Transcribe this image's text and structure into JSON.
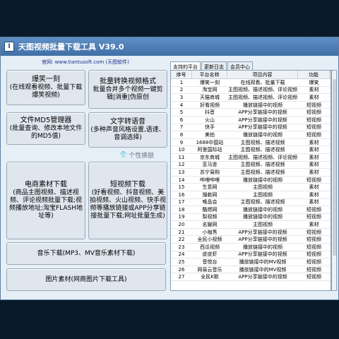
{
  "app": {
    "title": "天图视频批量下载工具 V39.0",
    "icon_label": "I"
  },
  "official": {
    "label": "官网:",
    "url": "www.tiantusoft.com",
    "paren": "(天图软件)"
  },
  "buttons": {
    "b1": {
      "main": "爆笑一刻",
      "sub": "(在线观看视频、批量下载爆笑视频)"
    },
    "b2": {
      "main": "批量转换视频格式",
      "sub": "批量合并多个视频一键剪辑|消重|伪原创"
    },
    "b3": {
      "main": "文件MD5管理器",
      "sub": "(批量查询、修改本地文件的MD5值)"
    },
    "b4": {
      "main": "文字转语音",
      "sub": "(多种声音风格设置,语速、音调选择)"
    },
    "skin": "个性换肤",
    "b5": {
      "main": "电商素材下载",
      "sub": "(商品主图视频、描述视频、评论视频批量下载;视频播放地址;淘宝FLASH地址等)"
    },
    "b6": {
      "main": "短视频下载",
      "sub": "(好看视频、抖音视频、美拍视频、火山视频、快手视频等播放链接或APP分享链接批量下载;网址批量生成)"
    },
    "b7": {
      "main": "音乐下载(MP3、MV音乐素材下载)"
    },
    "b8": {
      "main": "图片素材(网商图片下载工具)"
    }
  },
  "tabs": [
    "支持的平台",
    "更新日志",
    "会员中心"
  ],
  "table": {
    "columns": [
      "序号",
      "平台名称",
      "项目内容",
      "功能"
    ],
    "rows": [
      [
        "1",
        "爆笑一刻",
        "在线观看、批量下载",
        "爆笑"
      ],
      [
        "2",
        "淘宝网",
        "主图视频、描述视频、评论视频",
        "素材"
      ],
      [
        "3",
        "天猫商城",
        "主图视频、描述视频、评论视频",
        "素材"
      ],
      [
        "4",
        "好看视频",
        "播放链接中的视频",
        "短视频"
      ],
      [
        "5",
        "抖音",
        "APP分享链接中的视频",
        "短视频"
      ],
      [
        "6",
        "火山",
        "APP分享链接中的视频",
        "短视频"
      ],
      [
        "7",
        "快手",
        "APP分享链接中的视频",
        "短视频"
      ],
      [
        "8",
        "美拍",
        "播放链接中的视频",
        "短视频"
      ],
      [
        "9",
        "1688中国站",
        "主图视频、描述视频",
        "素材"
      ],
      [
        "10",
        "阿里国际站",
        "主图视频、描述视频",
        "素材"
      ],
      [
        "11",
        "京东商城",
        "主图视频、描述视频、评论视频",
        "素材"
      ],
      [
        "12",
        "亚马逊",
        "主图视频、描述视频",
        "素材"
      ],
      [
        "13",
        "苏宁易购",
        "主图视频、描述视频",
        "素材"
      ],
      [
        "14",
        "哔哩哔哩",
        "播放链接中的视频",
        "短视频"
      ],
      [
        "15",
        "生意网",
        "主图视频",
        "素材"
      ],
      [
        "16",
        "搜款网",
        "主图视频",
        "素材"
      ],
      [
        "17",
        "唯品会",
        "主图视频、描述视频",
        "素材"
      ],
      [
        "18",
        "酷燃网",
        "播放链接中的视频",
        "短视频"
      ],
      [
        "19",
        "梨视频",
        "播放链接中的视频",
        "短视频"
      ],
      [
        "20",
        "名媛网",
        "主图视频",
        "素材"
      ],
      [
        "21",
        "小咖秀",
        "APP分享链接中的视频",
        "短视频"
      ],
      [
        "22",
        "全民小视频",
        "APP分享链接中的视频",
        "短视频"
      ],
      [
        "23",
        "西瓜视频",
        "播放链接中的视频",
        "短视频"
      ],
      [
        "24",
        "皮皮虾",
        "APP分享链接中的视频",
        "短视频"
      ],
      [
        "25",
        "音悦台",
        "播放链接中的MV视频",
        "短视频"
      ],
      [
        "26",
        "网易云音乐",
        "播放链接中的MV视频",
        "短视频"
      ],
      [
        "27",
        "全民K歌",
        "APP分享链接中的视频",
        "短视频"
      ]
    ]
  }
}
